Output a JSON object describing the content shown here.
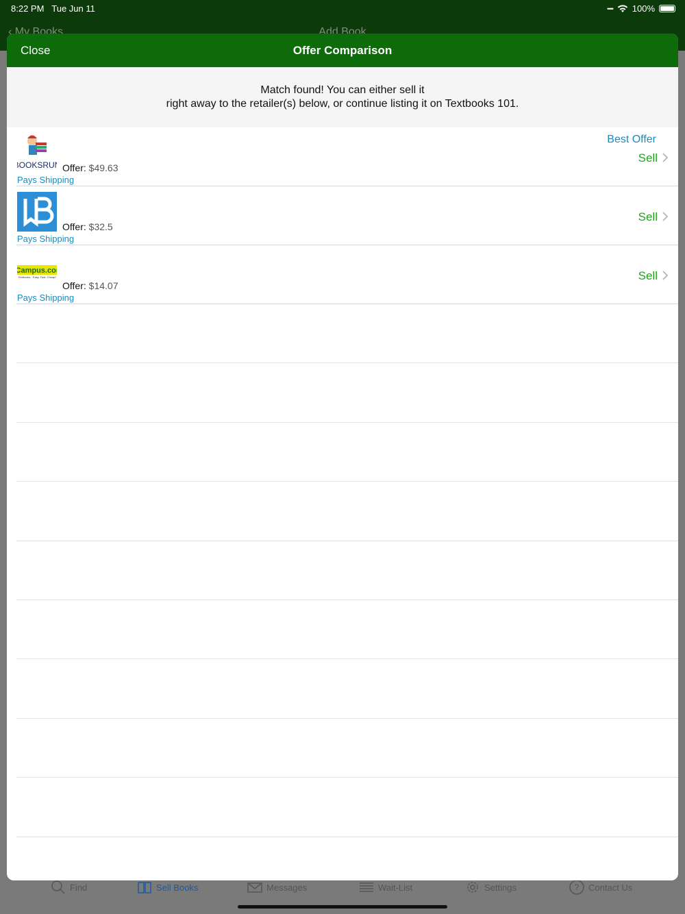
{
  "status_bar": {
    "time": "8:22 PM",
    "date": "Tue Jun 11",
    "battery": "100%"
  },
  "background": {
    "back_label": "My Books",
    "nav_title": "Add Book",
    "tabs": [
      {
        "label": "Find",
        "icon": "search-icon"
      },
      {
        "label": "Sell Books",
        "icon": "book-icon",
        "active": true
      },
      {
        "label": "Messages",
        "icon": "envelope-icon"
      },
      {
        "label": "Wait-List",
        "icon": "list-icon"
      },
      {
        "label": "Settings",
        "icon": "gear-icon"
      },
      {
        "label": "Contact Us",
        "icon": "question-icon"
      }
    ]
  },
  "modal": {
    "close_label": "Close",
    "title": "Offer Comparison",
    "notice_line1": "Match found! You can either sell it",
    "notice_line2": "right away to the retailer(s) below, or continue listing it on Textbooks 101."
  },
  "offers": [
    {
      "retailer_logo": "booksrun-logo",
      "logo_text": "BOOKSRUN",
      "offer_label": "Offer:",
      "amount": "$49.63",
      "shipping": "Pays Shipping",
      "best_offer": "Best Offer",
      "action": "Sell"
    },
    {
      "retailer_logo": "bookbyte-logo",
      "offer_label": "Offer:",
      "amount": "$32.5",
      "shipping": "Pays Shipping",
      "action": "Sell"
    },
    {
      "retailer_logo": "ecampus-logo",
      "logo_text": "eCampus.com",
      "logo_tagline": "Textbooks · Easy. Fast. Cheap!",
      "offer_label": "Offer:",
      "amount": "$14.07",
      "shipping": "Pays Shipping",
      "action": "Sell"
    }
  ],
  "colors": {
    "header_green": "#0d6b0a",
    "sell_green": "#1aa81a",
    "link_blue": "#1a8bbf"
  }
}
